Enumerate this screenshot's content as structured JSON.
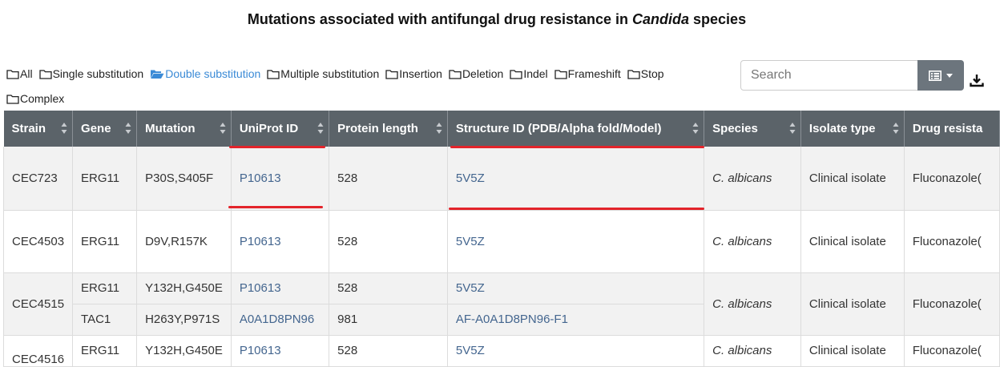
{
  "title": {
    "text": "Mutations associated with antifungal drug resistance in",
    "italic": "Candida",
    "suffix": "species"
  },
  "filters": [
    {
      "label": "All",
      "active": false
    },
    {
      "label": "Single substitution",
      "active": false
    },
    {
      "label": "Double substitution",
      "active": true
    },
    {
      "label": "Multiple substitution",
      "active": false
    },
    {
      "label": "Insertion",
      "active": false
    },
    {
      "label": "Deletion",
      "active": false
    },
    {
      "label": "Indel",
      "active": false
    },
    {
      "label": "Frameshift",
      "active": false
    },
    {
      "label": "Stop",
      "active": false
    },
    {
      "label": "Complex",
      "active": false
    }
  ],
  "search": {
    "placeholder": "Search",
    "value": ""
  },
  "toolbar": {
    "columns_icon": "list-columns-icon",
    "download_icon": "download-icon"
  },
  "table": {
    "headers": [
      "Strain",
      "Gene",
      "Mutation",
      "UniProt ID",
      "Protein length",
      "Structure ID (PDB/Alpha fold/Model)",
      "Species",
      "Isolate type",
      "Drug resista"
    ],
    "rows": [
      {
        "strain": "CEC723",
        "species": "C. albicans",
        "isolate": "Clinical isolate",
        "drug": "Fluconazole(",
        "genes": [
          {
            "gene": "ERG11",
            "mutation": "P30S,S405F",
            "uniprot": "P10613",
            "length": "528",
            "structure": "5V5Z"
          }
        ]
      },
      {
        "strain": "CEC4503",
        "species": "C. albicans",
        "isolate": "Clinical isolate",
        "drug": "Fluconazole(",
        "genes": [
          {
            "gene": "ERG11",
            "mutation": "D9V,R157K",
            "uniprot": "P10613",
            "length": "528",
            "structure": "5V5Z"
          }
        ]
      },
      {
        "strain": "CEC4515",
        "species": "C. albicans",
        "isolate": "Clinical isolate",
        "drug": "Fluconazole(",
        "genes": [
          {
            "gene": "ERG11",
            "mutation": "Y132H,G450E",
            "uniprot": "P10613",
            "length": "528",
            "structure": "5V5Z"
          },
          {
            "gene": "TAC1",
            "mutation": "H263Y,P971S",
            "uniprot": "A0A1D8PN96",
            "length": "981",
            "structure": "AF-A0A1D8PN96-F1"
          }
        ]
      },
      {
        "strain": "CEC4516",
        "species": "C. albicans",
        "isolate": "Clinical isolate",
        "drug": "Fluconazole(",
        "genes": [
          {
            "gene": "ERG11",
            "mutation": "Y132H,G450E",
            "uniprot": "P10613",
            "length": "528",
            "structure": "5V5Z"
          }
        ]
      }
    ]
  },
  "colors": {
    "header_bg": "#5b6369",
    "link": "#44668f",
    "active_filter": "#3a8ad6",
    "highlight": "#e3242b"
  }
}
